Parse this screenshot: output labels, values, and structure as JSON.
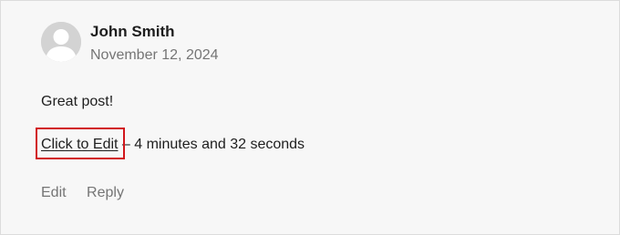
{
  "comment": {
    "author": "John Smith",
    "date": "November 12, 2024",
    "text": "Great post!",
    "edit_link_label": "Click to Edit",
    "edit_time_remaining": " – 4 minutes and 32 seconds",
    "avatar_icon": "person-silhouette-icon"
  },
  "actions": {
    "edit_label": "Edit",
    "reply_label": "Reply"
  },
  "colors": {
    "highlight": "#d1161b",
    "card_background": "#f7f7f7",
    "muted_text": "#757575"
  }
}
